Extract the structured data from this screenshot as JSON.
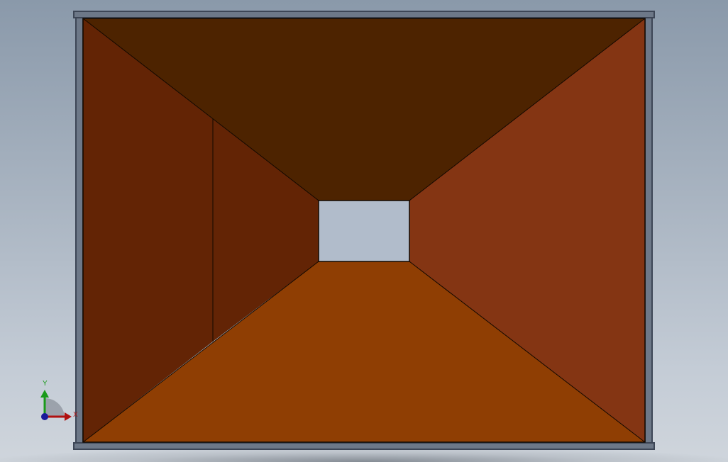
{
  "viewport": {
    "background_top": "#8a99aa",
    "background_bottom": "#cfd5dc"
  },
  "model": {
    "frame_color": "#3d4656",
    "frame_fill": "#6d7888",
    "top_face_color": "#4d2300",
    "left_outer_face_color": "#632405",
    "left_inner_face_color": "#632405",
    "right_face_color": "#843513",
    "bottom_face_color": "#8f3e03",
    "opening_color": "#b1bccb",
    "edge_color": "#120800"
  },
  "triad": {
    "y_label": "Y",
    "x_label": "X",
    "y_color": "#1a9a1a",
    "x_color": "#b01010",
    "origin_color": "#1a1a9a"
  }
}
